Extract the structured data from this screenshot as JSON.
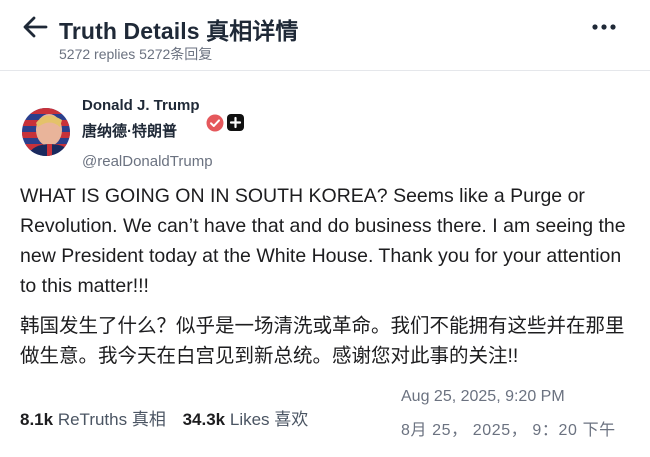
{
  "header": {
    "title": "Truth Details 真相详情",
    "subtitle": "5272 replies 5272条回复",
    "back_icon": "arrow-left-icon",
    "more_icon": "more-horizontal-icon"
  },
  "author": {
    "name": "Donald J. Trump",
    "name_cn": "唐纳德·特朗普",
    "handle": "@realDonaldTrump",
    "verified_icon": "verified-badge-icon",
    "verified_color": "#e5585c",
    "follow_icon": "plus-icon"
  },
  "post": {
    "text_en": "WHAT IS GOING ON IN SOUTH KOREA? Seems like a Purge or Revolution. We can’t have that and do business there. I am seeing the new President today at the White House. Thank you for your attention to this matter!!!",
    "text_cn": "韩国发生了什么？似乎是一场清洗或革命。我们不能拥有这些并在那里做生意。我今天在白宫见到新总统。感谢您对此事的关注!!"
  },
  "stats": {
    "retruths_count": "8.1k",
    "retruths_label": "ReTruths 真相",
    "likes_count": "34.3k",
    "likes_label": "Likes 喜欢"
  },
  "timestamp": {
    "en": "Aug 25, 2025, 9:20 PM",
    "cn": "8月 25，  2025，  9：20 下午"
  }
}
